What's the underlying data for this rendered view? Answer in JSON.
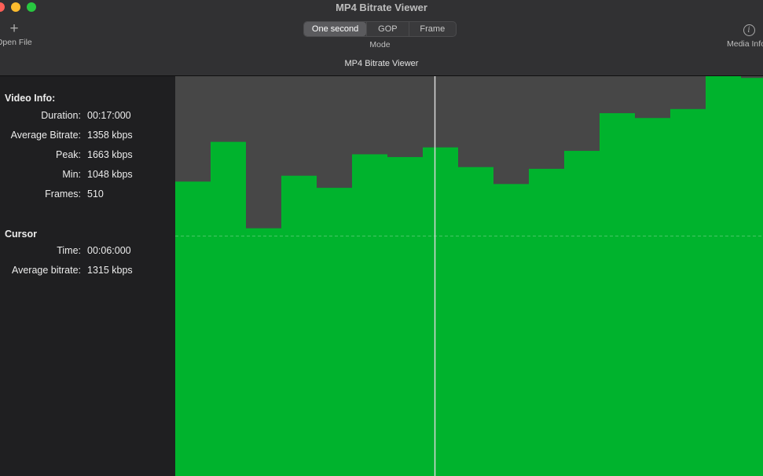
{
  "window": {
    "title": "MP4 Bitrate Viewer"
  },
  "toolbar": {
    "open_file": {
      "label": "Open File",
      "icon": "plus-icon"
    },
    "mode": {
      "label": "Mode",
      "options": [
        "One second",
        "GOP",
        "Frame"
      ],
      "selected": "One second"
    },
    "media_info": {
      "label": "Media Info",
      "icon": "info-icon"
    }
  },
  "subtitle": "MP4 Bitrate Viewer",
  "sidebar": {
    "video_info": {
      "title": "Video Info:",
      "rows": [
        {
          "key": "Duration:",
          "value": "00:17:000"
        },
        {
          "key": "Average Bitrate:",
          "value": "1358 kbps"
        },
        {
          "key": "Peak:",
          "value": "1663 kbps"
        },
        {
          "key": "Min:",
          "value": "1048 kbps"
        },
        {
          "key": "Frames:",
          "value": "510"
        }
      ]
    },
    "cursor": {
      "title": "Cursor",
      "rows": [
        {
          "key": "Time:",
          "value": "00:06:000"
        },
        {
          "key": "Average bitrate:",
          "value": "1315 kbps"
        }
      ]
    }
  },
  "chart_data": {
    "type": "bar",
    "title": "",
    "xlabel": "",
    "ylabel": "",
    "unit": "kbps",
    "x": [
      0,
      1,
      2,
      3,
      4,
      5,
      6,
      7,
      8,
      9,
      10,
      11,
      12,
      13,
      14,
      15,
      16
    ],
    "values": [
      1358,
      1473,
      1223,
      1375,
      1340,
      1437,
      1429,
      1457,
      1400,
      1351,
      1395,
      1447,
      1556,
      1542,
      1568,
      1663,
      1658
    ],
    "average": 1358,
    "cursor_index": 6,
    "bar_color": "#00b32d",
    "plot_background": "#474747"
  }
}
